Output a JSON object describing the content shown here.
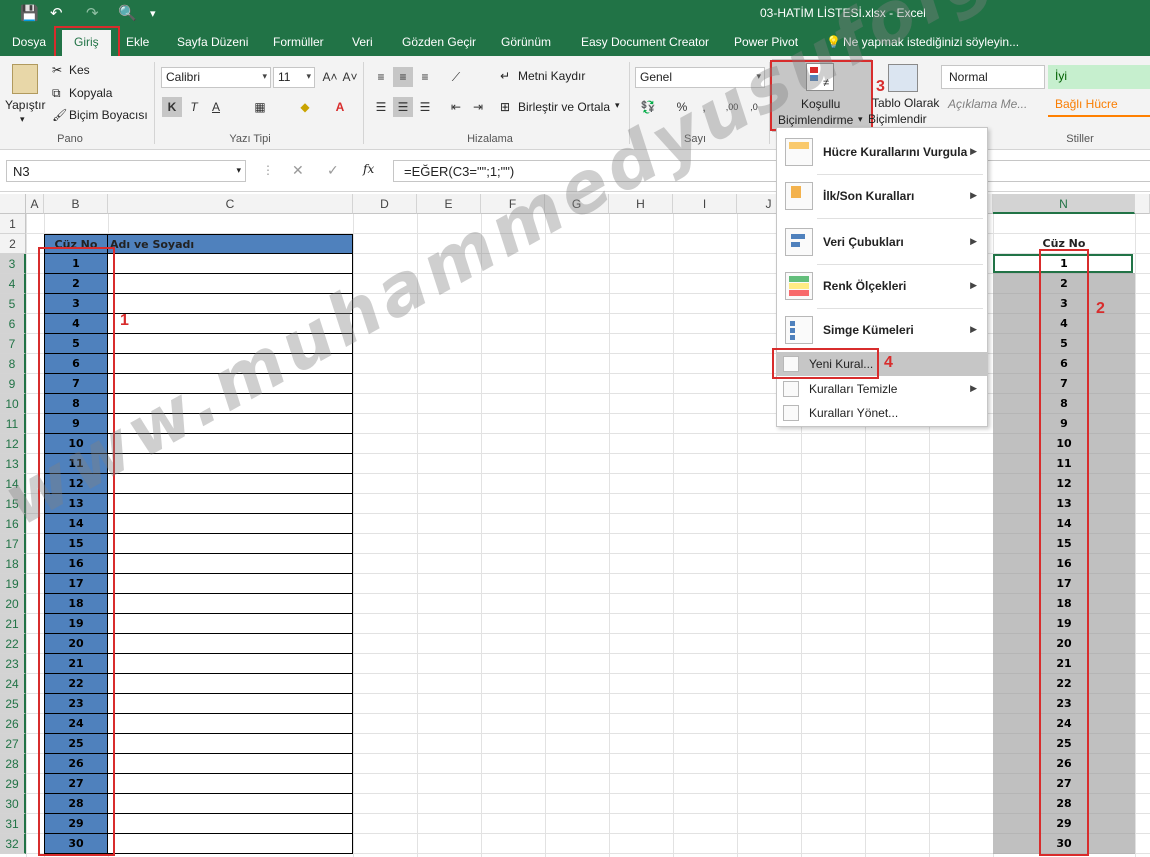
{
  "window": {
    "title": "03-HATİM LİSTESİ.xlsx - Excel"
  },
  "quick_access": {
    "save": "💾",
    "undo": "↶",
    "redo": "↷",
    "preview": "🔍",
    "more": "▾"
  },
  "tabs": [
    {
      "label": "Dosya"
    },
    {
      "label": "Giriş"
    },
    {
      "label": "Ekle"
    },
    {
      "label": "Sayfa Düzeni"
    },
    {
      "label": "Formüller"
    },
    {
      "label": "Veri"
    },
    {
      "label": "Gözden Geçir"
    },
    {
      "label": "Görünüm"
    },
    {
      "label": "Easy Document Creator"
    },
    {
      "label": "Power Pivot"
    }
  ],
  "tell_me": "Ne yapmak istediğinizi söyleyin...",
  "ribbon": {
    "pano": {
      "paste": "Yapıştır",
      "cut": "Kes",
      "copy": "Kopyala",
      "format_painter": "Biçim Boyacısı",
      "label": "Pano"
    },
    "font": {
      "name": "Calibri",
      "size": "11",
      "label": "Yazı Tipi",
      "bold": "K",
      "italic": "T",
      "underline": "A"
    },
    "align": {
      "wrap": "Metni Kaydır",
      "merge": "Birleştir ve Ortala",
      "label": "Hizalama"
    },
    "number": {
      "format": "Genel",
      "label": "Sayı"
    },
    "styles": {
      "conditional_line1": "Koşullu",
      "conditional_line2": "Biçimlendirme",
      "table_line1": "Tablo Olarak",
      "table_line2": "Biçimlendir",
      "normal": "Normal",
      "good": "İyi",
      "explanation": "Açıklama Me...",
      "linked": "Bağlı Hücre",
      "label": "Stiller"
    }
  },
  "formula_bar": {
    "name_box": "N3",
    "formula": "=EĞER(C3=\"\";1;\"\")",
    "fx": "fx",
    "cancel": "✕",
    "confirm": "✓"
  },
  "columns": [
    "A",
    "B",
    "C",
    "D",
    "E",
    "F",
    "G",
    "H",
    "I",
    "J",
    "N"
  ],
  "rows": [
    "1",
    "2",
    "3",
    "4",
    "5",
    "6",
    "7",
    "8",
    "9",
    "10",
    "11",
    "12",
    "13",
    "14",
    "15",
    "16",
    "17",
    "18",
    "19",
    "20",
    "21",
    "22",
    "23",
    "24",
    "25",
    "26",
    "27",
    "28",
    "29",
    "30",
    "31",
    "32"
  ],
  "table": {
    "header_b": "Cüz No",
    "header_c": "Adı ve Soyadı",
    "values": [
      "1",
      "2",
      "3",
      "4",
      "5",
      "6",
      "7",
      "8",
      "9",
      "10",
      "11",
      "12",
      "13",
      "14",
      "15",
      "16",
      "17",
      "18",
      "19",
      "20",
      "21",
      "22",
      "23",
      "24",
      "25",
      "26",
      "27",
      "28",
      "29",
      "30"
    ]
  },
  "col_n": {
    "header": "Cüz No"
  },
  "cf_menu": {
    "items": [
      {
        "label": "Hücre Kurallarını Vurgula"
      },
      {
        "label": "İlk/Son Kuralları"
      },
      {
        "label": "Veri Çubukları"
      },
      {
        "label": "Renk Ölçekleri"
      },
      {
        "label": "Simge Kümeleri"
      }
    ],
    "new_rule": "Yeni Kural...",
    "clear_rules": "Kuralları Temizle",
    "manage_rules": "Kuralları Yönet..."
  },
  "annotations": [
    "1",
    "2",
    "3",
    "4"
  ],
  "watermark": "www.muhammedyusufolgun.blogspot.com.tr",
  "colors": {
    "excel_green": "#217346",
    "blue_cell": "#4f81bd",
    "grey_cell": "#c0c0c0",
    "annotation_red": "#d82c2c"
  }
}
